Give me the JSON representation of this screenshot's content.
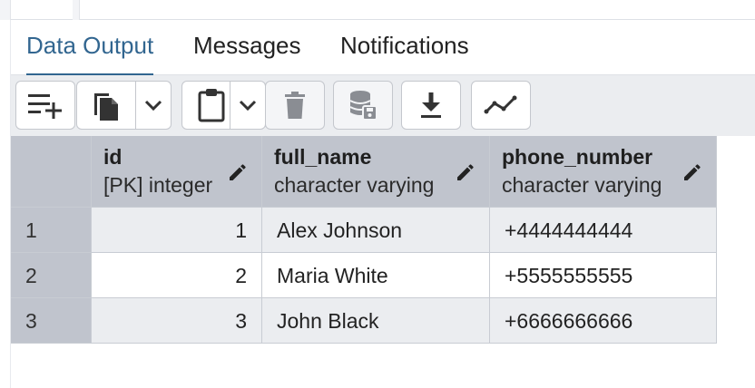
{
  "tabs": [
    {
      "label": "Data Output",
      "active": true
    },
    {
      "label": "Messages",
      "active": false
    },
    {
      "label": "Notifications",
      "active": false
    }
  ],
  "toolbar": {
    "buttons": [
      {
        "icon": "add-row-icon"
      },
      {
        "icon": "copy-icon"
      },
      {
        "icon": "chevron-down-icon"
      },
      {
        "icon": "paste-icon"
      },
      {
        "icon": "chevron-down-icon"
      },
      {
        "icon": "delete-icon"
      },
      {
        "icon": "save-data-icon"
      },
      {
        "icon": "download-icon"
      },
      {
        "icon": "graph-icon"
      }
    ]
  },
  "grid": {
    "columns": [
      {
        "name": "id",
        "type": "[PK] integer"
      },
      {
        "name": "full_name",
        "type": "character varying"
      },
      {
        "name": "phone_number",
        "type": "character varying"
      }
    ],
    "rows": [
      {
        "num": "1",
        "id": "1",
        "full_name": "Alex Johnson",
        "phone_number": "+4444444444"
      },
      {
        "num": "2",
        "id": "2",
        "full_name": "Maria White",
        "phone_number": "+5555555555"
      },
      {
        "num": "3",
        "id": "3",
        "full_name": "John Black",
        "phone_number": "+6666666666"
      }
    ]
  },
  "colors": {
    "accent": "#326690",
    "header_bg": "#c0c4cd",
    "toolbar_bg": "#ebedf0"
  }
}
